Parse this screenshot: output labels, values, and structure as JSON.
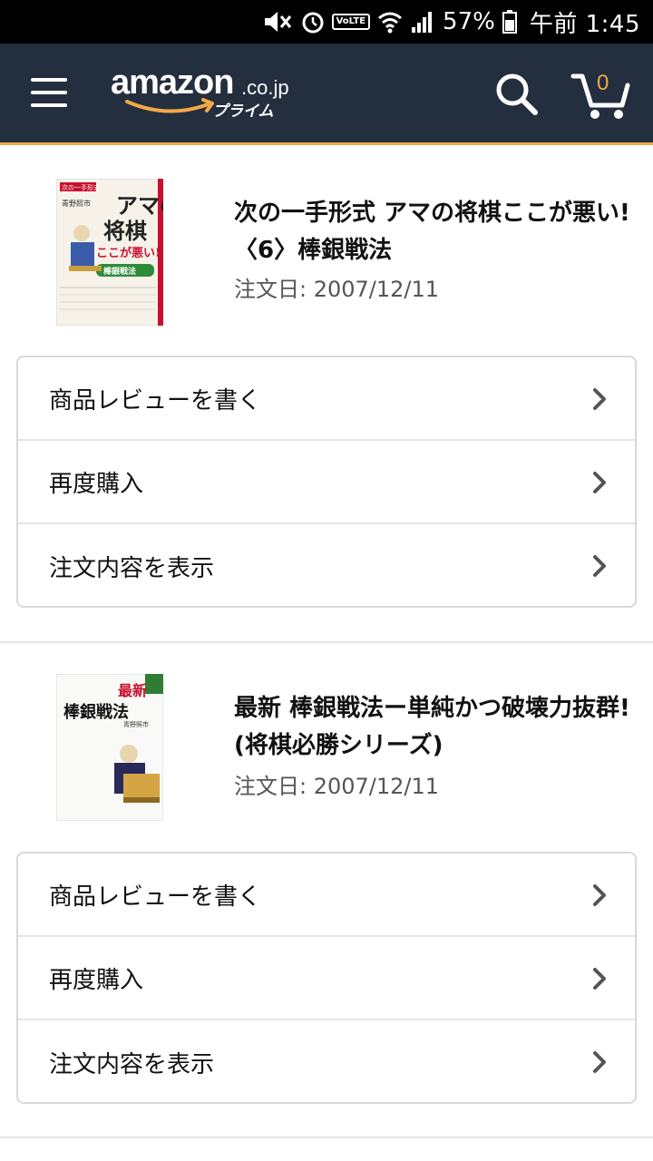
{
  "status_bar": {
    "battery_percent": "57%",
    "time": "午前 1:45",
    "volte": "VoLTE"
  },
  "header": {
    "logo_word": "amazon",
    "logo_domain": ".co.jp",
    "logo_prime": "プライム",
    "cart_count": "0",
    "accent_color": "#f3a847",
    "background_color": "#232f3e"
  },
  "orders": [
    {
      "title": "次の一手形式 アマの将棋ここが悪い!〈6〉棒銀戦法",
      "order_date": "注文日: 2007/12/11",
      "cover": {
        "top_label": "次の一手形式",
        "title_line1": "アマの",
        "title_line2": "将棋",
        "subtitle": "ここが悪い!",
        "band": "棒銀戦法",
        "author": "青野照市"
      },
      "actions": [
        "商品レビューを書く",
        "再度購入",
        "注文内容を表示"
      ]
    },
    {
      "title": "最新 棒銀戦法ー単純かつ破壊力抜群! (将棋必勝シリーズ)",
      "order_date": "注文日: 2007/12/11",
      "cover": {
        "title_top": "最新",
        "title_main": "棒銀戦法",
        "author": "青野照市"
      },
      "actions": [
        "商品レビューを書く",
        "再度購入",
        "注文内容を表示"
      ]
    }
  ]
}
